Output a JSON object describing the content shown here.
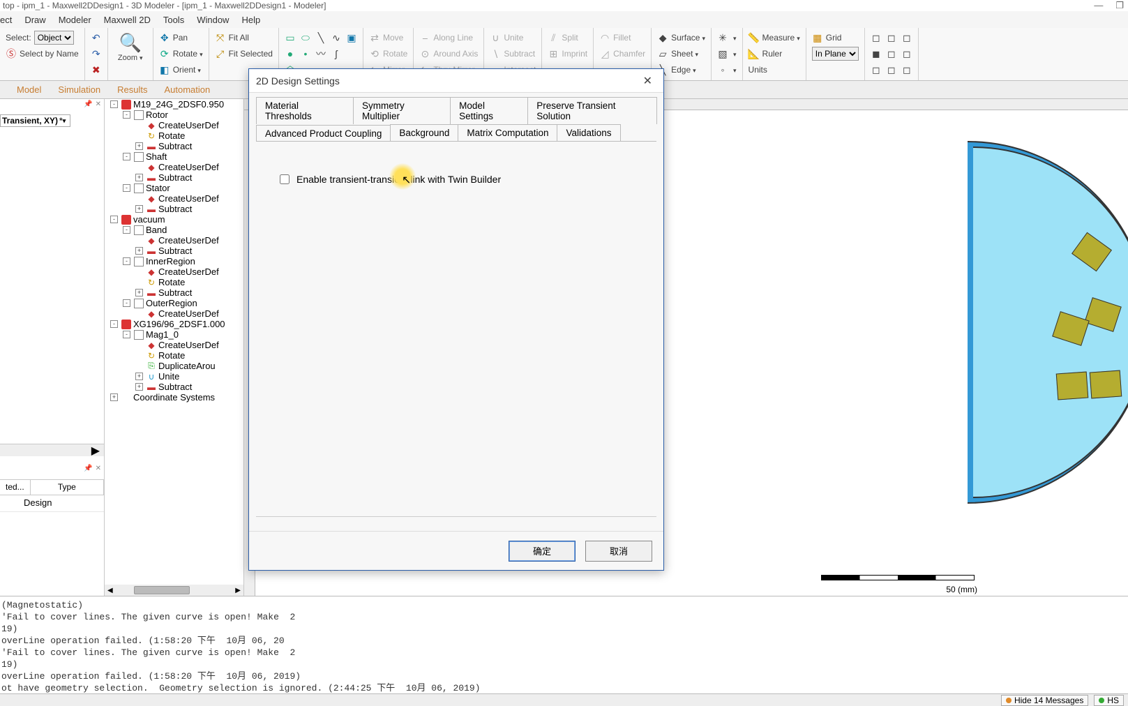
{
  "window": {
    "title": "top - ipm_1 - Maxwell2DDesign1 - 3D Modeler - [ipm_1 - Maxwell2DDesign1 - Modeler]",
    "min": "—",
    "restore": "❐"
  },
  "menu": [
    "ect",
    "Draw",
    "Modeler",
    "Maxwell 2D",
    "Tools",
    "Window",
    "Help"
  ],
  "ribbon": {
    "select_label": "Select:",
    "select_value": "Object",
    "select_by_name": "Select by Name",
    "zoom": "Zoom",
    "pan": "Pan",
    "rotate": "Rotate",
    "orient": "Orient",
    "fit_all": "Fit All",
    "fit_selected": "Fit Selected",
    "move": "Move",
    "rotate2": "Rotate",
    "mirror": "Mirror",
    "along_line": "Along Line",
    "around_axis": "Around Axis",
    "thru_mirror": "Thru Mirror",
    "unite": "Unite",
    "subtract": "Subtract",
    "intersect": "Intersect",
    "split": "Split",
    "imprint": "Imprint",
    "fillet": "Fillet",
    "chamfer": "Chamfer",
    "surface": "Surface",
    "sheet": "Sheet",
    "edge": "Edge",
    "measure": "Measure",
    "grid": "Grid",
    "ruler": "Ruler",
    "units": "Units",
    "in_plane": "In Plane"
  },
  "panel_tabs": [
    "Model",
    "Simulation",
    "Results",
    "Automation"
  ],
  "left": {
    "solution": "Transient, XY)",
    "scroll_arrow": "▶",
    "table_headers": [
      "ted...",
      "Type"
    ],
    "table_cell": "Design"
  },
  "tree": [
    {
      "depth": 0,
      "tog": "-",
      "ico": "red",
      "label": "M19_24G_2DSF0.950"
    },
    {
      "depth": 1,
      "tog": "-",
      "ico": "box",
      "label": "Rotor"
    },
    {
      "depth": 2,
      "tog": "",
      "ico": "create",
      "label": "CreateUserDef"
    },
    {
      "depth": 2,
      "tog": "",
      "ico": "rotate",
      "label": "Rotate"
    },
    {
      "depth": 2,
      "tog": "+",
      "ico": "subtract",
      "label": "Subtract"
    },
    {
      "depth": 1,
      "tog": "-",
      "ico": "box",
      "label": "Shaft"
    },
    {
      "depth": 2,
      "tog": "",
      "ico": "create",
      "label": "CreateUserDef"
    },
    {
      "depth": 2,
      "tog": "+",
      "ico": "subtract",
      "label": "Subtract"
    },
    {
      "depth": 1,
      "tog": "-",
      "ico": "box",
      "label": "Stator"
    },
    {
      "depth": 2,
      "tog": "",
      "ico": "create",
      "label": "CreateUserDef"
    },
    {
      "depth": 2,
      "tog": "+",
      "ico": "subtract",
      "label": "Subtract"
    },
    {
      "depth": 0,
      "tog": "-",
      "ico": "red",
      "label": "vacuum"
    },
    {
      "depth": 1,
      "tog": "-",
      "ico": "box",
      "label": "Band"
    },
    {
      "depth": 2,
      "tog": "",
      "ico": "create",
      "label": "CreateUserDef"
    },
    {
      "depth": 2,
      "tog": "+",
      "ico": "subtract",
      "label": "Subtract"
    },
    {
      "depth": 1,
      "tog": "-",
      "ico": "box",
      "label": "InnerRegion"
    },
    {
      "depth": 2,
      "tog": "",
      "ico": "create",
      "label": "CreateUserDef"
    },
    {
      "depth": 2,
      "tog": "",
      "ico": "rotate",
      "label": "Rotate"
    },
    {
      "depth": 2,
      "tog": "+",
      "ico": "subtract",
      "label": "Subtract"
    },
    {
      "depth": 1,
      "tog": "-",
      "ico": "box",
      "label": "OuterRegion"
    },
    {
      "depth": 2,
      "tog": "",
      "ico": "create",
      "label": "CreateUserDef"
    },
    {
      "depth": 0,
      "tog": "-",
      "ico": "red",
      "label": "XG196/96_2DSF1.000"
    },
    {
      "depth": 1,
      "tog": "-",
      "ico": "box",
      "label": "Mag1_0"
    },
    {
      "depth": 2,
      "tog": "",
      "ico": "create",
      "label": "CreateUserDef"
    },
    {
      "depth": 2,
      "tog": "",
      "ico": "rotate",
      "label": "Rotate"
    },
    {
      "depth": 2,
      "tog": "",
      "ico": "dup",
      "label": "DuplicateArou"
    },
    {
      "depth": 2,
      "tog": "+",
      "ico": "unite",
      "label": "Unite"
    },
    {
      "depth": 2,
      "tog": "+",
      "ico": "subtract",
      "label": "Subtract"
    },
    {
      "depth": 0,
      "tog": "+",
      "ico": "",
      "label": "Coordinate Systems"
    }
  ],
  "dialog": {
    "title": "2D Design Settings",
    "tabs_row1": [
      "Material Thresholds",
      "Symmetry Multiplier",
      "Model Settings",
      "Preserve Transient Solution"
    ],
    "tabs_row2": [
      "Advanced Product Coupling",
      "Background",
      "Matrix Computation",
      "Validations"
    ],
    "selected_tab": "Advanced Product Coupling",
    "checkbox_label": "Enable transient-transient link with Twin Builder",
    "ok": "确定",
    "cancel": "取消",
    "close": "✕"
  },
  "canvas": {
    "scale_label": "50 (mm)"
  },
  "messages": [
    "(Magnetostatic)",
    "'Fail to cover lines. The given curve is open! Make  2",
    "19)",
    "overLine operation failed. (1:58:20 下午  10月 06, 20",
    "'Fail to cover lines. The given curve is open! Make  2",
    "19)",
    "overLine operation failed. (1:58:20 下午  10月 06, 2019)",
    "ot have geometry selection.  Geometry selection is ignored. (2:44:25 下午  10月 06, 2019)"
  ],
  "status": {
    "hide": "Hide 14 Messages",
    "hs": "HS"
  }
}
